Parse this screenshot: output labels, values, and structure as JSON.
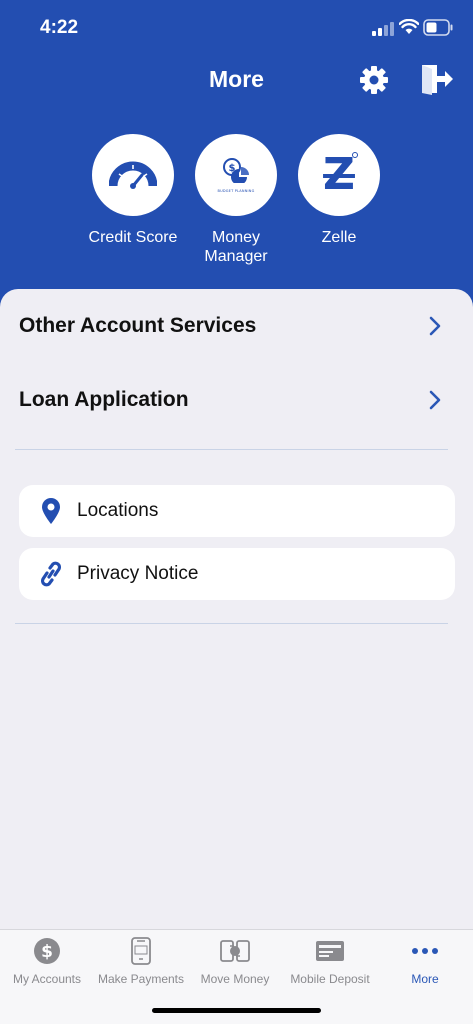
{
  "status_bar": {
    "time": "4:22"
  },
  "header": {
    "title": "More",
    "shortcuts": [
      {
        "label_lines": [
          "Credit Score"
        ],
        "icon": "gauge-icon"
      },
      {
        "label_lines": [
          "Money",
          "Manager"
        ],
        "icon": "budget-planning-icon",
        "icon_text": "BUDGET PLANNING"
      },
      {
        "label_lines": [
          "Zelle"
        ],
        "icon": "zelle-icon",
        "icon_text": "Z"
      }
    ]
  },
  "menu": {
    "primary": [
      {
        "label": "Other Account Services"
      },
      {
        "label": "Loan Application"
      }
    ],
    "cards": [
      {
        "label": "Locations",
        "icon": "location-pin-icon"
      },
      {
        "label": "Privacy Notice",
        "icon": "link-icon"
      }
    ]
  },
  "tabbar": {
    "tabs": [
      {
        "label": "My Accounts",
        "icon": "dollar-circle-icon",
        "active": false
      },
      {
        "label": "Make Payments",
        "icon": "pay-icon",
        "active": false
      },
      {
        "label": "Move Money",
        "icon": "transfer-icon",
        "active": false
      },
      {
        "label": "Mobile Deposit",
        "icon": "check-deposit-icon",
        "active": false
      },
      {
        "label": "More",
        "icon": "more-dots-icon",
        "active": true
      }
    ]
  },
  "colors": {
    "brand_blue": "#234eb1",
    "accent_blue": "#2a57b6",
    "background": "#efeef4"
  }
}
